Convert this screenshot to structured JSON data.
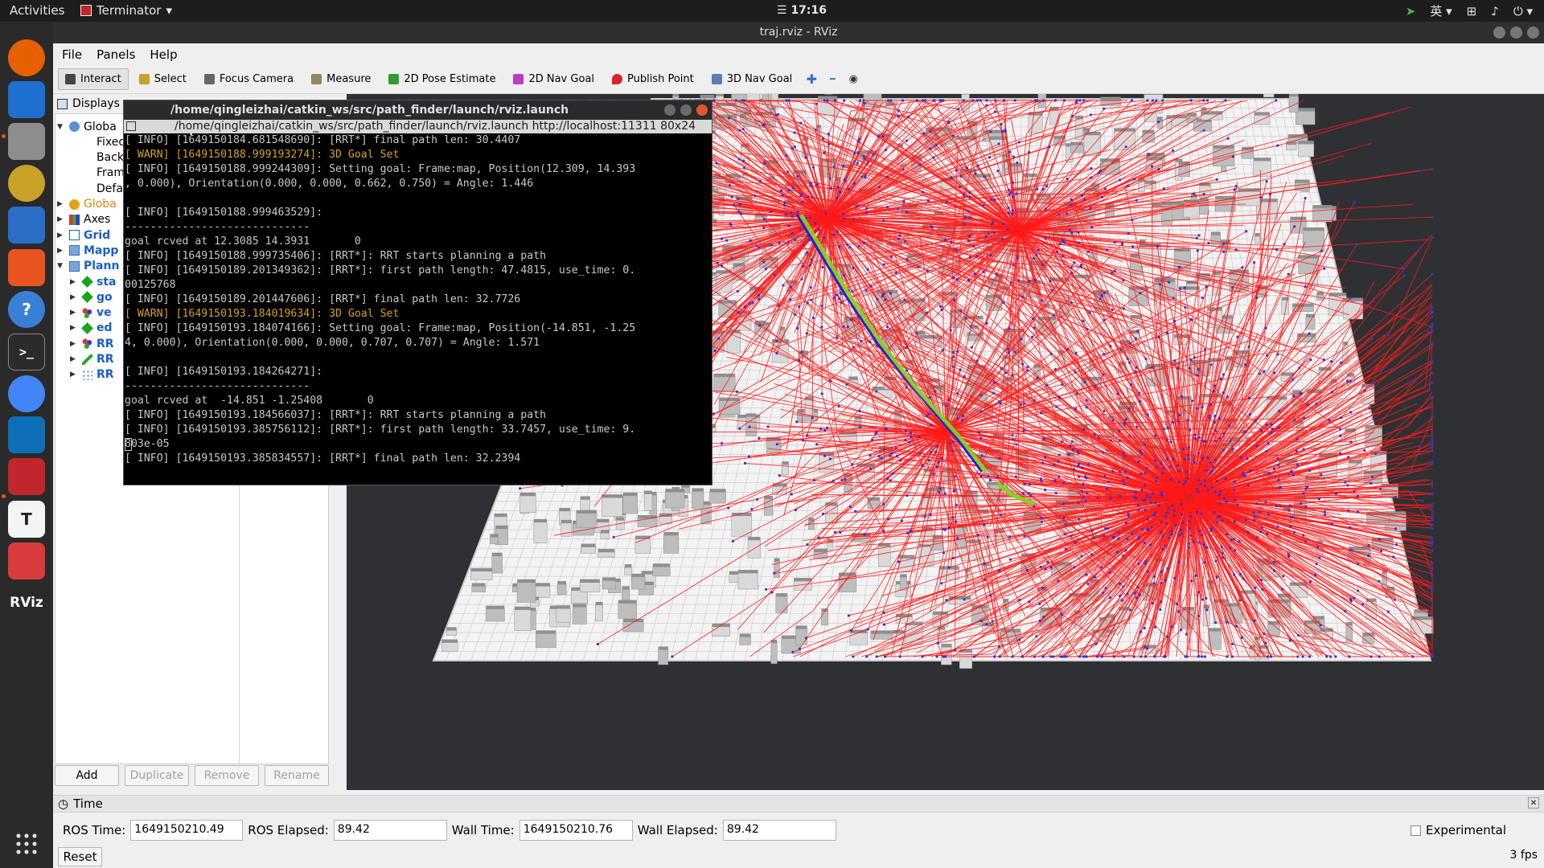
{
  "topbar": {
    "activities": "Activities",
    "app_name": "Terminator",
    "clock": "17:16",
    "ime": "英"
  },
  "dock": {
    "items": [
      {
        "name": "firefox-icon",
        "color": "#e66000"
      },
      {
        "name": "thunderbird-icon",
        "color": "#1f6fd1"
      },
      {
        "name": "files-icon",
        "color": "#8d8d8d"
      },
      {
        "name": "rhythmbox-icon",
        "color": "#c9a227"
      },
      {
        "name": "libreoffice-writer-icon",
        "color": "#2a6ec8"
      },
      {
        "name": "ubuntu-software-icon",
        "color": "#e95420"
      },
      {
        "name": "help-icon",
        "color": "#3a7fd6"
      },
      {
        "name": "terminal-icon",
        "color": "#2b2b2b"
      },
      {
        "name": "chrome-icon",
        "color": "#4285f4"
      },
      {
        "name": "vscode-icon",
        "color": "#0e6fb8"
      },
      {
        "name": "terminator-icon",
        "color": "#c0262b"
      },
      {
        "name": "typora-icon",
        "color": "#f4f4f4"
      },
      {
        "name": "screenshot-icon",
        "color": "#d83b3b"
      },
      {
        "name": "rviz-icon",
        "color": "#2a2a2a"
      }
    ],
    "rviz_label": "RViz",
    "terminal_glyph": ">_",
    "typora_glyph": "T",
    "help_glyph": "?"
  },
  "rviz": {
    "window_title": "traj.rviz - RViz",
    "menu": [
      "File",
      "Panels",
      "Help"
    ],
    "toolbar": [
      {
        "label": "Interact",
        "icon": "interact-icon",
        "active": true
      },
      {
        "label": "Select",
        "icon": "select-icon",
        "active": false
      },
      {
        "label": "Focus Camera",
        "icon": "focus-camera-icon",
        "active": false
      },
      {
        "label": "Measure",
        "icon": "measure-icon",
        "active": false
      },
      {
        "label": "2D Pose Estimate",
        "icon": "pose-estimate-icon",
        "active": false
      },
      {
        "label": "2D Nav Goal",
        "icon": "nav-goal-icon",
        "active": false
      },
      {
        "label": "Publish Point",
        "icon": "publish-point-icon",
        "active": false
      },
      {
        "label": "3D Nav Goal",
        "icon": "3d-nav-goal-icon",
        "active": false
      }
    ],
    "displays": {
      "title": "Displays",
      "tree": [
        {
          "label": "Globa",
          "level": 0,
          "expanded": true,
          "style": "normal",
          "icon": "global-options-icon"
        },
        {
          "label": "Fixed",
          "level": 1,
          "expanded": null,
          "style": "normal",
          "icon": ""
        },
        {
          "label": "Backg",
          "level": 1,
          "expanded": null,
          "style": "normal",
          "icon": ""
        },
        {
          "label": "Frame",
          "level": 1,
          "expanded": null,
          "style": "normal",
          "icon": ""
        },
        {
          "label": "Defau",
          "level": 1,
          "expanded": null,
          "style": "normal",
          "icon": ""
        },
        {
          "label": "Globa",
          "level": 0,
          "expanded": false,
          "style": "orange",
          "icon": "warning-icon"
        },
        {
          "label": "Axes",
          "level": 0,
          "expanded": false,
          "style": "normal",
          "icon": "axes-icon"
        },
        {
          "label": "Grid",
          "level": 0,
          "expanded": false,
          "style": "blue",
          "icon": "grid-icon"
        },
        {
          "label": "Mapp",
          "level": 0,
          "expanded": false,
          "style": "blue",
          "icon": "folder-icon"
        },
        {
          "label": "Plann",
          "level": 0,
          "expanded": true,
          "style": "blue",
          "icon": "folder-icon"
        },
        {
          "label": "sta",
          "level": 1,
          "expanded": false,
          "style": "blue",
          "icon": "marker-green-icon"
        },
        {
          "label": "go",
          "level": 1,
          "expanded": false,
          "style": "blue",
          "icon": "marker-green-icon"
        },
        {
          "label": "ve",
          "level": 1,
          "expanded": false,
          "style": "blue",
          "icon": "marker-array-icon"
        },
        {
          "label": "ed",
          "level": 1,
          "expanded": false,
          "style": "blue",
          "icon": "marker-green-icon"
        },
        {
          "label": "RR",
          "level": 1,
          "expanded": false,
          "style": "blue",
          "icon": "marker-array-icon"
        },
        {
          "label": "RR",
          "level": 1,
          "expanded": false,
          "style": "blue",
          "icon": "path-icon"
        },
        {
          "label": "RR",
          "level": 1,
          "expanded": false,
          "style": "blue",
          "icon": "pointcloud-icon"
        }
      ],
      "buttons": [
        {
          "label": "Add",
          "enabled": true
        },
        {
          "label": "Duplicate",
          "enabled": false
        },
        {
          "label": "Remove",
          "enabled": false
        },
        {
          "label": "Rename",
          "enabled": false
        }
      ]
    },
    "time": {
      "title": "Time",
      "ros_time_label": "ROS Time:",
      "ros_time": "1649150210.49",
      "ros_elapsed_label": "ROS Elapsed:",
      "ros_elapsed": "89.42",
      "wall_time_label": "Wall Time:",
      "wall_time": "1649150210.76",
      "wall_elapsed_label": "Wall Elapsed:",
      "wall_elapsed": "89.42",
      "experimental_label": "Experimental",
      "reset_label": "Reset",
      "fps": "3 fps"
    }
  },
  "terminal": {
    "title": "/home/qingleizhai/catkin_ws/src/path_finder/launch/rviz.launch http://localhost:11311",
    "subtitle": "/home/qingleizhai/catkin_ws/src/path_finder/launch/rviz.launch http://localhost:11311 80x24",
    "lines": [
      {
        "text": "[ INFO] [1649150184.681548690]: [RRT*] final path len: 30.4407",
        "level": "info"
      },
      {
        "text": "[ WARN] [1649150188.999193274]: 3D Goal Set",
        "level": "warn"
      },
      {
        "text": "[ INFO] [1649150188.999244309]: Setting goal: Frame:map, Position(12.309, 14.393",
        "level": "info"
      },
      {
        "text": ", 0.000), Orientation(0.000, 0.000, 0.662, 0.750) = Angle: 1.446",
        "level": "info"
      },
      {
        "text": "",
        "level": "info"
      },
      {
        "text": "[ INFO] [1649150188.999463529]:",
        "level": "info"
      },
      {
        "text": "-----------------------------",
        "level": "info"
      },
      {
        "text": "goal rcved at 12.3085 14.3931       0",
        "level": "info"
      },
      {
        "text": "[ INFO] [1649150188.999735406]: [RRT*]: RRT starts planning a path",
        "level": "info"
      },
      {
        "text": "[ INFO] [1649150189.201349362]: [RRT*]: first path length: 47.4815, use_time: 0.",
        "level": "info"
      },
      {
        "text": "00125768",
        "level": "info"
      },
      {
        "text": "[ INFO] [1649150189.201447606]: [RRT*] final path len: 32.7726",
        "level": "info"
      },
      {
        "text": "[ WARN] [1649150193.184019634]: 3D Goal Set",
        "level": "warn"
      },
      {
        "text": "[ INFO] [1649150193.184074166]: Setting goal: Frame:map, Position(-14.851, -1.25",
        "level": "info"
      },
      {
        "text": "4, 0.000), Orientation(0.000, 0.000, 0.707, 0.707) = Angle: 1.571",
        "level": "info"
      },
      {
        "text": "",
        "level": "info"
      },
      {
        "text": "[ INFO] [1649150193.184264271]:",
        "level": "info"
      },
      {
        "text": "-----------------------------",
        "level": "info"
      },
      {
        "text": "goal rcved at  -14.851 -1.25408       0",
        "level": "info"
      },
      {
        "text": "[ INFO] [1649150193.184566037]: [RRT*]: RRT starts planning a path",
        "level": "info"
      },
      {
        "text": "[ INFO] [1649150193.385756112]: [RRT*]: first path length: 33.7457, use_time: 9.",
        "level": "info"
      },
      {
        "text": "803e-05",
        "level": "info"
      },
      {
        "text": "[ INFO] [1649150193.385834557]: [RRT*] final path len: 32.2394",
        "level": "info"
      }
    ]
  },
  "colors": {
    "tree_edges": "#ff1a1a",
    "tree_nodes": "#3b33c9",
    "path_green": "#7dd81f",
    "path_blue": "#2a1fd6",
    "obstacle": "#d9d9d9",
    "floor": "#f3f3f3",
    "background": "#2f3033",
    "warn_text": "#d4a419"
  }
}
